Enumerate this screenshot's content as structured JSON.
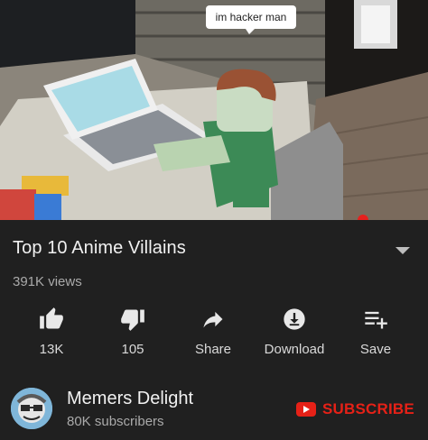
{
  "video": {
    "speech_bubble": "im hacker man"
  },
  "meta": {
    "title": "Top 10 Anime Villains",
    "views": "391K views"
  },
  "actions": [
    {
      "icon": "thumbs-up-icon",
      "label": "13K"
    },
    {
      "icon": "thumbs-down-icon",
      "label": "105"
    },
    {
      "icon": "share-icon",
      "label": "Share"
    },
    {
      "icon": "download-icon",
      "label": "Download"
    },
    {
      "icon": "save-playlist-icon",
      "label": "Save"
    }
  ],
  "channel": {
    "name": "Memers Delight",
    "subscribers": "80K subscribers",
    "subscribe_label": "SUBSCRIBE"
  },
  "colors": {
    "background": "#202020",
    "accent": "#e62117"
  }
}
